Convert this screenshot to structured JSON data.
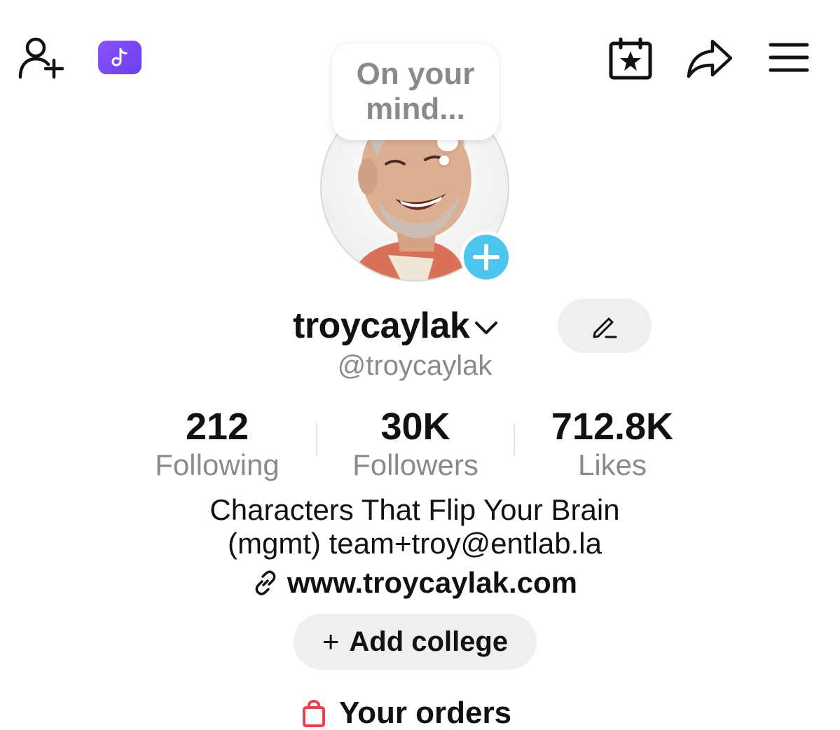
{
  "top_bar": {
    "add_friend_icon": "person-plus-icon",
    "ticket_icon": "tiktok-ticket-icon",
    "calendar_icon": "calendar-star-icon",
    "share_icon": "share-arrow-icon",
    "menu_icon": "hamburger-menu-icon",
    "ticket_color": "#7b4bf4"
  },
  "note_bubble": {
    "text": "On your\nmind..."
  },
  "profile": {
    "avatar": "profile-photo",
    "add_story_color": "#4cc6ef",
    "display_name": "troycaylak",
    "handle": "@troycaylak"
  },
  "stats": [
    {
      "value": "212",
      "label": "Following"
    },
    {
      "value": "30K",
      "label": "Followers"
    },
    {
      "value": "712.8K",
      "label": "Likes"
    }
  ],
  "bio": {
    "line1": "Characters That Flip Your Brain",
    "line2": "(mgmt) team+troy@entlab.la",
    "link": "www.troycaylak.com"
  },
  "actions": {
    "add_college_plus": "+",
    "add_college": "Add college",
    "orders": "Your orders"
  }
}
